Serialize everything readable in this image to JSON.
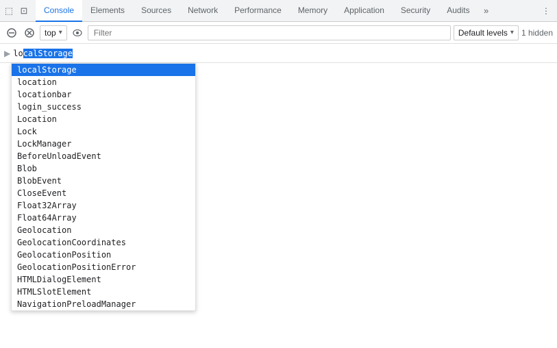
{
  "tabBar": {
    "icons": [
      {
        "name": "inspect-icon",
        "symbol": "⬚"
      },
      {
        "name": "device-icon",
        "symbol": "⊡"
      }
    ],
    "tabs": [
      {
        "id": "console",
        "label": "Console",
        "active": true
      },
      {
        "id": "elements",
        "label": "Elements",
        "active": false
      },
      {
        "id": "sources",
        "label": "Sources",
        "active": false
      },
      {
        "id": "network",
        "label": "Network",
        "active": false
      },
      {
        "id": "performance",
        "label": "Performance",
        "active": false
      },
      {
        "id": "memory",
        "label": "Memory",
        "active": false
      },
      {
        "id": "application",
        "label": "Application",
        "active": false
      },
      {
        "id": "security",
        "label": "Security",
        "active": false
      },
      {
        "id": "audits",
        "label": "Audits",
        "active": false
      }
    ],
    "more_symbol": "»",
    "menu_symbol": "⋮"
  },
  "toolbar": {
    "clear_symbol": "🚫",
    "stop_symbol": "⊘",
    "context_label": "top",
    "context_arrow": "▾",
    "eye_symbol": "👁",
    "filter_placeholder": "Filter",
    "log_level_label": "Default levels",
    "log_level_arrow": "▾",
    "hidden_count": "1 hidden"
  },
  "console": {
    "input_arrow": "▶",
    "input_text": "lo",
    "highlight": "calStorage"
  },
  "autocomplete": {
    "selected_index": 0,
    "items": [
      "localStorage",
      "location",
      "locationbar",
      "login_success",
      "Location",
      "Lock",
      "LockManager",
      "BeforeUnloadEvent",
      "Blob",
      "BlobEvent",
      "CloseEvent",
      "Float32Array",
      "Float64Array",
      "Geolocation",
      "GeolocationCoordinates",
      "GeolocationPosition",
      "GeolocationPositionError",
      "HTMLDialogElement",
      "HTMLSlotElement",
      "NavigationPreloadManager"
    ]
  }
}
